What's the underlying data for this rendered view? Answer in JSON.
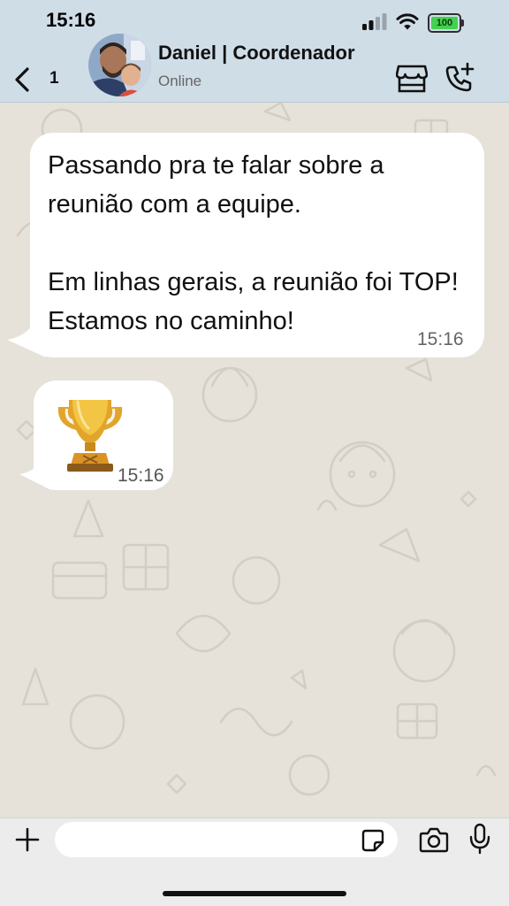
{
  "status_bar": {
    "time": "15:16",
    "battery_level": "100",
    "battery_color": "#43d14f"
  },
  "header": {
    "unread_count": "1",
    "contact_name": "Daniel | Coordenador",
    "contact_status": "Online",
    "icons": [
      "chevron-left-icon",
      "store-icon",
      "call-add-icon"
    ]
  },
  "messages": [
    {
      "text": "Passando pra te falar sobre a reunião com a equipe.\n\nEm linhas gerais, a reunião foi TOP! Estamos no caminho!",
      "time": "15:16",
      "direction": "incoming"
    },
    {
      "emoji": "trophy",
      "time": "15:16",
      "direction": "incoming"
    }
  ],
  "composer": {
    "placeholder": "",
    "icons": [
      "plus-icon",
      "sticker-icon",
      "camera-icon",
      "mic-icon"
    ]
  },
  "colors": {
    "header_bg": "#cfdde7",
    "wallpaper": "#e6e1d9",
    "bubble": "#ffffff",
    "composer_bg": "#ececec"
  }
}
